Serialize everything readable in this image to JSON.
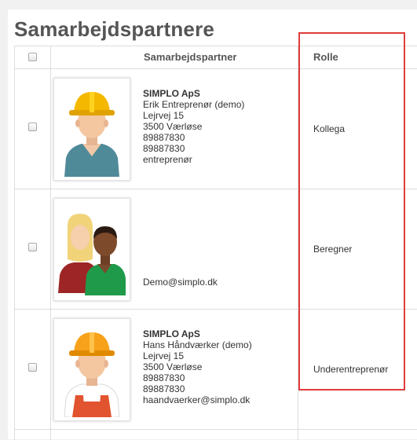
{
  "page": {
    "title": "Samarbejdspartnere"
  },
  "table": {
    "columns": {
      "partner": "Samarbejdspartner",
      "role": "Rolle"
    },
    "rows": [
      {
        "avatar": "construction-worker-avatar",
        "company": "SIMPLO ApS",
        "name": "Erik Entreprenør (demo)",
        "street": "Lejrvej 15",
        "city": "3500  Værløse",
        "phone": "89887830",
        "phone2": "89887830",
        "extra": "entreprenør",
        "role": "Kollega"
      },
      {
        "avatar": "group-avatar",
        "email": "Demo@simplo.dk",
        "role": "Beregner"
      },
      {
        "avatar": "craftsman-avatar",
        "company": "SIMPLO ApS",
        "name": "Hans Håndværker (demo)",
        "street": "Lejrvej 15",
        "city": "3500  Værløse",
        "phone": "89887830",
        "phone2": "89887830",
        "extra": "haandvaerker@simplo.dk",
        "role": "Underentreprenør"
      }
    ]
  },
  "colors": {
    "highlight": "#e03c3c",
    "helmet": "#f5b800",
    "shirt_teal": "#4f8a99"
  }
}
